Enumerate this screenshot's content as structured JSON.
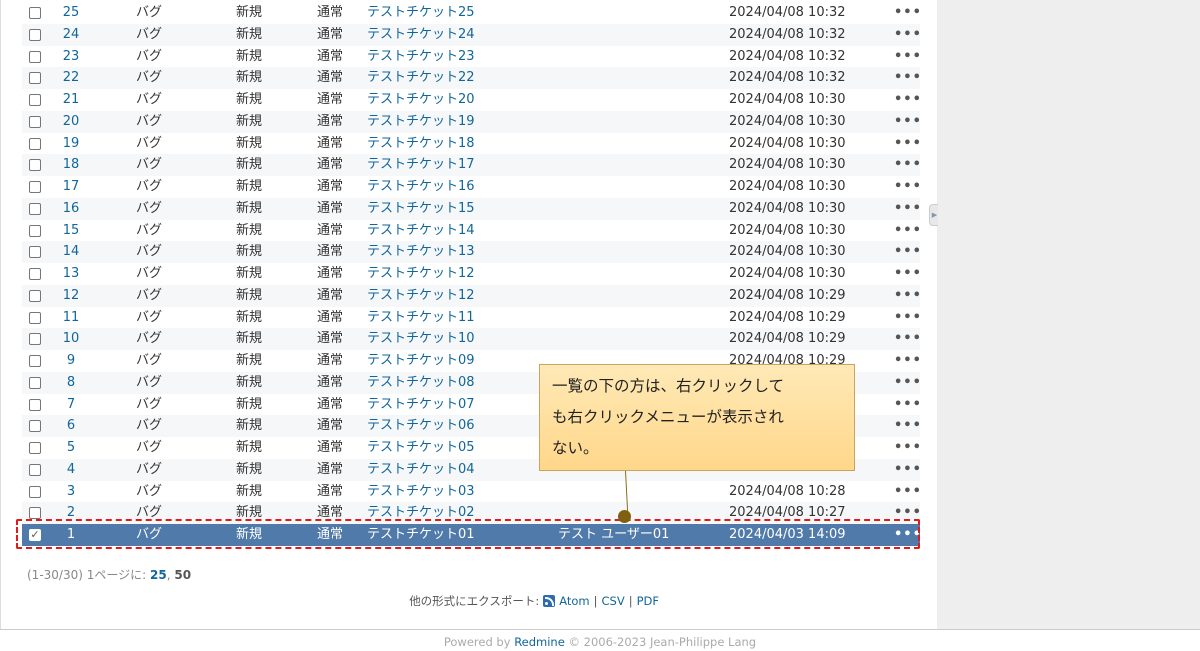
{
  "issues": [
    {
      "id": "25",
      "tracker": "バグ",
      "status": "新規",
      "priority": "通常",
      "subject": "テストチケット25",
      "assignee": "",
      "updated": "2024/04/08 10:32"
    },
    {
      "id": "24",
      "tracker": "バグ",
      "status": "新規",
      "priority": "通常",
      "subject": "テストチケット24",
      "assignee": "",
      "updated": "2024/04/08 10:32"
    },
    {
      "id": "23",
      "tracker": "バグ",
      "status": "新規",
      "priority": "通常",
      "subject": "テストチケット23",
      "assignee": "",
      "updated": "2024/04/08 10:32"
    },
    {
      "id": "22",
      "tracker": "バグ",
      "status": "新規",
      "priority": "通常",
      "subject": "テストチケット22",
      "assignee": "",
      "updated": "2024/04/08 10:32"
    },
    {
      "id": "21",
      "tracker": "バグ",
      "status": "新規",
      "priority": "通常",
      "subject": "テストチケット20",
      "assignee": "",
      "updated": "2024/04/08 10:30"
    },
    {
      "id": "20",
      "tracker": "バグ",
      "status": "新規",
      "priority": "通常",
      "subject": "テストチケット19",
      "assignee": "",
      "updated": "2024/04/08 10:30"
    },
    {
      "id": "19",
      "tracker": "バグ",
      "status": "新規",
      "priority": "通常",
      "subject": "テストチケット18",
      "assignee": "",
      "updated": "2024/04/08 10:30"
    },
    {
      "id": "18",
      "tracker": "バグ",
      "status": "新規",
      "priority": "通常",
      "subject": "テストチケット17",
      "assignee": "",
      "updated": "2024/04/08 10:30"
    },
    {
      "id": "17",
      "tracker": "バグ",
      "status": "新規",
      "priority": "通常",
      "subject": "テストチケット16",
      "assignee": "",
      "updated": "2024/04/08 10:30"
    },
    {
      "id": "16",
      "tracker": "バグ",
      "status": "新規",
      "priority": "通常",
      "subject": "テストチケット15",
      "assignee": "",
      "updated": "2024/04/08 10:30"
    },
    {
      "id": "15",
      "tracker": "バグ",
      "status": "新規",
      "priority": "通常",
      "subject": "テストチケット14",
      "assignee": "",
      "updated": "2024/04/08 10:30"
    },
    {
      "id": "14",
      "tracker": "バグ",
      "status": "新規",
      "priority": "通常",
      "subject": "テストチケット13",
      "assignee": "",
      "updated": "2024/04/08 10:30"
    },
    {
      "id": "13",
      "tracker": "バグ",
      "status": "新規",
      "priority": "通常",
      "subject": "テストチケット12",
      "assignee": "",
      "updated": "2024/04/08 10:30"
    },
    {
      "id": "12",
      "tracker": "バグ",
      "status": "新規",
      "priority": "通常",
      "subject": "テストチケット12",
      "assignee": "",
      "updated": "2024/04/08 10:29"
    },
    {
      "id": "11",
      "tracker": "バグ",
      "status": "新規",
      "priority": "通常",
      "subject": "テストチケット11",
      "assignee": "",
      "updated": "2024/04/08 10:29"
    },
    {
      "id": "10",
      "tracker": "バグ",
      "status": "新規",
      "priority": "通常",
      "subject": "テストチケット10",
      "assignee": "",
      "updated": "2024/04/08 10:29"
    },
    {
      "id": "9",
      "tracker": "バグ",
      "status": "新規",
      "priority": "通常",
      "subject": "テストチケット09",
      "assignee": "",
      "updated": "2024/04/08 10:29"
    },
    {
      "id": "8",
      "tracker": "バグ",
      "status": "新規",
      "priority": "通常",
      "subject": "テストチケット08",
      "assignee": "",
      "updated": ""
    },
    {
      "id": "7",
      "tracker": "バグ",
      "status": "新規",
      "priority": "通常",
      "subject": "テストチケット07",
      "assignee": "",
      "updated": ""
    },
    {
      "id": "6",
      "tracker": "バグ",
      "status": "新規",
      "priority": "通常",
      "subject": "テストチケット06",
      "assignee": "",
      "updated": ""
    },
    {
      "id": "5",
      "tracker": "バグ",
      "status": "新規",
      "priority": "通常",
      "subject": "テストチケット05",
      "assignee": "",
      "updated": ""
    },
    {
      "id": "4",
      "tracker": "バグ",
      "status": "新規",
      "priority": "通常",
      "subject": "テストチケット04",
      "assignee": "",
      "updated": ""
    },
    {
      "id": "3",
      "tracker": "バグ",
      "status": "新規",
      "priority": "通常",
      "subject": "テストチケット03",
      "assignee": "",
      "updated": "2024/04/08 10:28"
    },
    {
      "id": "2",
      "tracker": "バグ",
      "status": "新規",
      "priority": "通常",
      "subject": "テストチケット02",
      "assignee": "",
      "updated": "2024/04/08 10:27"
    },
    {
      "id": "1",
      "tracker": "バグ",
      "status": "新規",
      "priority": "通常",
      "subject": "テストチケット01",
      "assignee": "テスト ユーザー01",
      "updated": "2024/04/03 14:09",
      "selected": true
    }
  ],
  "row_menu_label": "•••",
  "callout": {
    "text": "一覧の下の方は、右クリックして\nも右クリックメニューが表示され\nない。"
  },
  "pagination": {
    "range": "(1-30/30)",
    "per_page_label": "1ページに:",
    "option_25": "25",
    "option_sep": ",",
    "option_50": "50"
  },
  "export": {
    "label": "他の形式にエクスポート:",
    "atom": "Atom",
    "sep": "|",
    "csv": "CSV",
    "pdf": "PDF"
  },
  "footer": {
    "powered_by": "Powered by",
    "redmine": "Redmine",
    "copyright": "© 2006-2023 Jean-Philippe Lang"
  },
  "sidebar_toggle_icon": "chevron-right-icon",
  "colors": {
    "selected_row": "#507aaa",
    "link": "#116699",
    "callout_bg": "#ffd78a",
    "outline": "#e01b1b"
  }
}
